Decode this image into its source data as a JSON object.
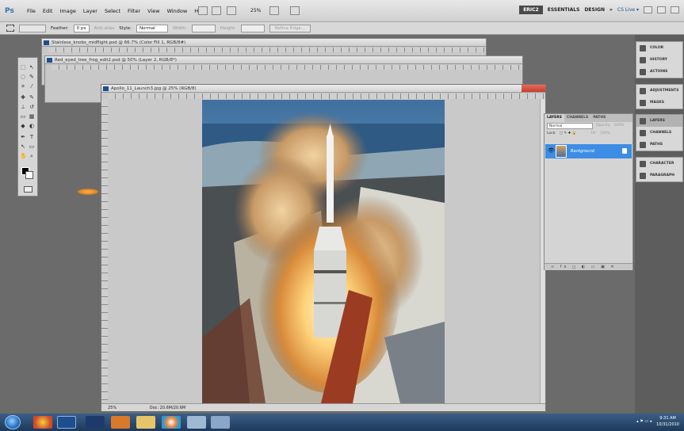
{
  "app": {
    "logo": "Ps"
  },
  "menubar": {
    "items": [
      "File",
      "Edit",
      "Image",
      "Layer",
      "Select",
      "Filter",
      "View",
      "Window",
      "Help"
    ],
    "zoom": "25%",
    "workspace": {
      "active": "ERIC2",
      "others": [
        "ESSENTIALS",
        "DESIGN",
        "»"
      ]
    },
    "cslive": "CS Live ▾"
  },
  "options": {
    "feather_label": "Feather:",
    "feather_value": "0 px",
    "antialias": "Anti-alias",
    "style_label": "Style:",
    "style_value": "Normal",
    "width_label": "Width:",
    "height_label": "Height:",
    "refine_edge": "Refine Edge..."
  },
  "documents": [
    {
      "title": "Stainless_knobs_midflight.psd @ 66.7% (Color Fill 1, RGB/8#)"
    },
    {
      "title": "Red_eyed_tree_frog_edit2.psd @ 50% (Layer 2, RGB/8*)"
    }
  ],
  "main_document": {
    "title": "Apollo_11_Launch3.jpg @ 25% (RGB/8)",
    "status_zoom": "25%",
    "status_doc": "Doc: 20.6M/20.6M"
  },
  "layers_panel": {
    "tabs": [
      "LAYERS",
      "CHANNELS",
      "PATHS"
    ],
    "blend_mode": "Normal",
    "opacity_label": "Opacity:",
    "opacity_value": "100%",
    "lock_label": "Lock:",
    "fill_label": "Fill:",
    "fill_value": "100%",
    "layer_name": "Background"
  },
  "dock": {
    "group1": [
      "COLOR",
      "HISTORY",
      "ACTIONS"
    ],
    "group2": [
      "ADJUSTMENTS",
      "MASKS"
    ],
    "group3": [
      "LAYERS",
      "CHANNELS",
      "PATHS"
    ],
    "group4": [
      "CHARACTER",
      "PARAGRAPH"
    ]
  },
  "taskbar": {
    "clock_time": "9:31 AM",
    "clock_date": "10/31/2010"
  }
}
